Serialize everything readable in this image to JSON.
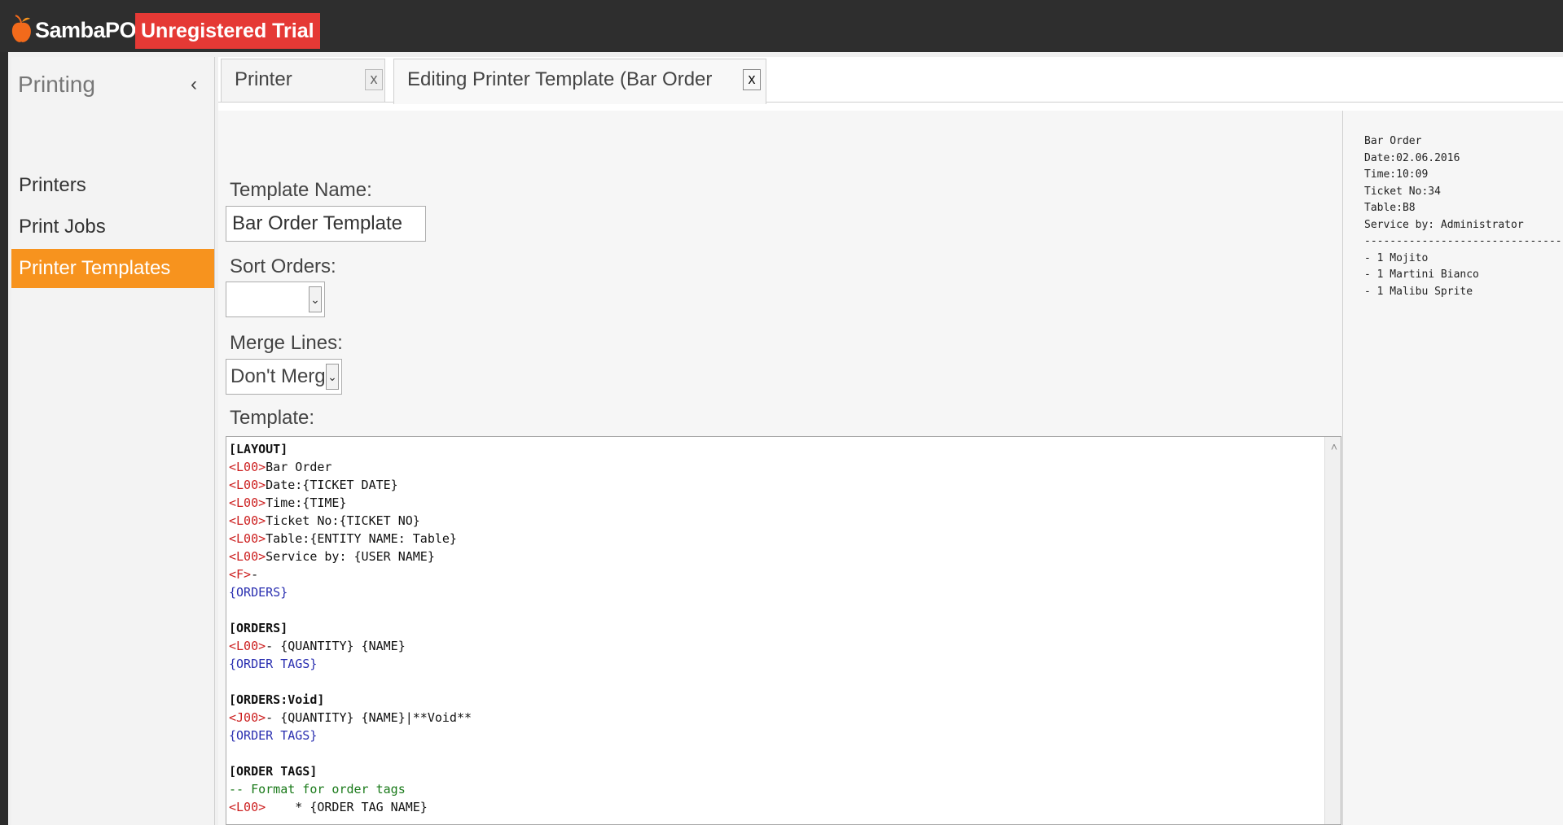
{
  "app": {
    "name": "SambaPOS",
    "badge": "Unregistered Trial"
  },
  "sidebar": {
    "title": "Printing",
    "items": [
      {
        "label": "Printers",
        "active": false
      },
      {
        "label": "Print Jobs",
        "active": false
      },
      {
        "label": "Printer Templates",
        "active": true
      }
    ]
  },
  "tabs": [
    {
      "label": "Printer Templates",
      "close": "x"
    },
    {
      "label": "Editing Printer Template (Bar Order Template)",
      "close": "x"
    }
  ],
  "form": {
    "name_label": "Template Name:",
    "name_value": "Bar Order Template",
    "sort_label": "Sort Orders:",
    "sort_value": "",
    "merge_label": "Merge Lines:",
    "merge_value": "Don't Merge",
    "template_label": "Template:"
  },
  "template_lines": [
    [
      {
        "t": "[LAYOUT]",
        "c": "sect"
      }
    ],
    [
      {
        "t": "<L00>",
        "c": "tag"
      },
      {
        "t": "Bar Order",
        "c": ""
      }
    ],
    [
      {
        "t": "<L00>",
        "c": "tag"
      },
      {
        "t": "Date:{TICKET DATE}",
        "c": ""
      }
    ],
    [
      {
        "t": "<L00>",
        "c": "tag"
      },
      {
        "t": "Time:{TIME}",
        "c": ""
      }
    ],
    [
      {
        "t": "<L00>",
        "c": "tag"
      },
      {
        "t": "Ticket No:{TICKET NO}",
        "c": ""
      }
    ],
    [
      {
        "t": "<L00>",
        "c": "tag"
      },
      {
        "t": "Table:{ENTITY NAME: Table}",
        "c": ""
      }
    ],
    [
      {
        "t": "<L00>",
        "c": "tag"
      },
      {
        "t": "Service by: {USER NAME}",
        "c": ""
      }
    ],
    [
      {
        "t": "<F>",
        "c": "tag"
      },
      {
        "t": "-",
        "c": ""
      }
    ],
    [
      {
        "t": "{ORDERS}",
        "c": "blue"
      }
    ],
    [],
    [
      {
        "t": "[ORDERS]",
        "c": "sect"
      }
    ],
    [
      {
        "t": "<L00>",
        "c": "tag"
      },
      {
        "t": "- {QUANTITY} {NAME}",
        "c": ""
      }
    ],
    [
      {
        "t": "{ORDER TAGS}",
        "c": "blue"
      }
    ],
    [],
    [
      {
        "t": "[ORDERS:Void]",
        "c": "sect"
      }
    ],
    [
      {
        "t": "<J00>",
        "c": "tag"
      },
      {
        "t": "- {QUANTITY} {NAME}|**Void**",
        "c": ""
      }
    ],
    [
      {
        "t": "{ORDER TAGS}",
        "c": "blue"
      }
    ],
    [],
    [
      {
        "t": "[ORDER TAGS]",
        "c": "sect"
      }
    ],
    [
      {
        "t": "-- Format for order tags",
        "c": "green"
      }
    ],
    [
      {
        "t": "<L00>",
        "c": "tag"
      },
      {
        "t": "    * {ORDER TAG NAME}",
        "c": ""
      }
    ]
  ],
  "preview_lines": [
    "Bar Order",
    "Date:02.06.2016",
    "Time:10:09",
    "Ticket No:34",
    "Table:B8",
    "Service by: Administrator",
    "--------------------------------",
    "- 1 Mojito",
    "- 1 Martini Bianco",
    "- 1 Malibu Sprite"
  ],
  "colors": {
    "accent": "#f7931e",
    "badge": "#e53935",
    "titlebar": "#2e2e2e"
  }
}
